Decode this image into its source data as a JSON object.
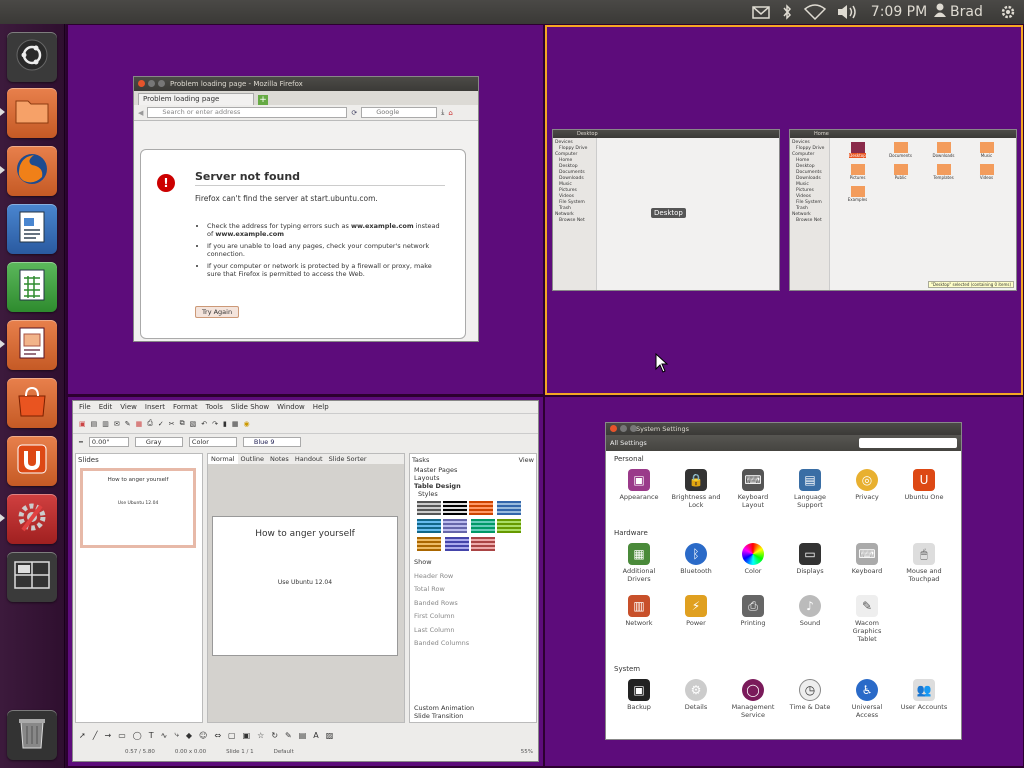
{
  "topbar": {
    "time": "7:09 PM",
    "user": "Brad",
    "icons": [
      "mail-icon",
      "bluetooth-icon",
      "wifi-icon",
      "volume-icon",
      "user-icon",
      "power-gear-icon"
    ]
  },
  "launcher": {
    "items": [
      "dash-home",
      "files",
      "firefox",
      "writer",
      "calc",
      "impress",
      "software-center",
      "ubuntu-one",
      "system-settings",
      "workspace-switcher",
      "trash"
    ]
  },
  "firefox": {
    "title": "Problem loading page - Mozilla Firefox",
    "tab": "Problem loading page",
    "url_placeholder": "Search or enter address",
    "search_engine": "Google",
    "heading": "Server not found",
    "subtitle": "Firefox can't find the server at start.ubuntu.com.",
    "bullet1a": "Check the address for typing errors such as ",
    "bullet1b": "ww.example.com",
    "bullet1c": " instead of ",
    "bullet1d": "www.example.com",
    "bullet2": "If you are unable to load any pages, check your computer's network connection.",
    "bullet3": "If your computer or network is protected by a firewall or proxy, make sure that Firefox is permitted to access the Web.",
    "try_again": "Try Again"
  },
  "files": {
    "title1": "Desktop",
    "title2": "Home",
    "sidebar_devices": "Devices",
    "sidebar_floppy": "Floppy Drive",
    "sidebar_computer": "Computer",
    "sidebar_items": [
      "Home",
      "Desktop",
      "Documents",
      "Downloads",
      "Music",
      "Pictures",
      "Videos",
      "File System",
      "Trash"
    ],
    "sidebar_network": "Network",
    "sidebar_browse": "Browse Net",
    "desktop_label": "Desktop",
    "home_items": [
      "Desktop",
      "Documents",
      "Downloads",
      "Music",
      "Pictures",
      "Public",
      "Templates",
      "Videos",
      "Examples"
    ],
    "status": "\"Desktop\" selected (containing 0 items)"
  },
  "impress": {
    "menus": [
      "File",
      "Edit",
      "View",
      "Insert",
      "Format",
      "Tools",
      "Slide Show",
      "Window",
      "Help"
    ],
    "line_width": "0.00\"",
    "color_combo": "Gray",
    "area_combo": "Color",
    "fill_combo": "Blue 9",
    "slides_label": "Slides",
    "tabs": [
      "Normal",
      "Outline",
      "Notes",
      "Handout",
      "Slide Sorter"
    ],
    "slide_title": "How to anger yourself",
    "slide_body": "Use Ubuntu 12.04",
    "tasks_label": "Tasks",
    "view_label": "View",
    "task_sections": [
      "Master Pages",
      "Layouts",
      "Table Design"
    ],
    "styles_label": "Styles",
    "show_label": "Show",
    "show_options": [
      "Header Row",
      "Total Row",
      "Banded Rows",
      "First Column",
      "Last Column",
      "Banded Columns"
    ],
    "bottom_sections": [
      "Custom Animation",
      "Slide Transition"
    ],
    "status": [
      "0.57 / 5.80",
      "0.00 x 0.00",
      "Slide 1 / 1",
      "Default",
      "55%"
    ]
  },
  "settings": {
    "title": "System Settings",
    "all_settings": "All Settings",
    "sections": [
      {
        "name": "Personal",
        "items": [
          "Appearance",
          "Brightness and Lock",
          "Keyboard Layout",
          "Language Support",
          "Privacy",
          "Ubuntu One"
        ]
      },
      {
        "name": "Hardware",
        "items": [
          "Additional Drivers",
          "Bluetooth",
          "Color",
          "Displays",
          "Keyboard",
          "Mouse and Touchpad",
          "Network",
          "Power",
          "Printing",
          "Sound",
          "Wacom Graphics Tablet"
        ]
      },
      {
        "name": "System",
        "items": [
          "Backup",
          "Details",
          "Management Service",
          "Time & Date",
          "Universal Access",
          "User Accounts"
        ]
      }
    ]
  },
  "colors": {
    "workspace_bg": "#5d0c7b",
    "accent_orange": "#f5a623",
    "ubuntu_orange": "#dd4814"
  }
}
